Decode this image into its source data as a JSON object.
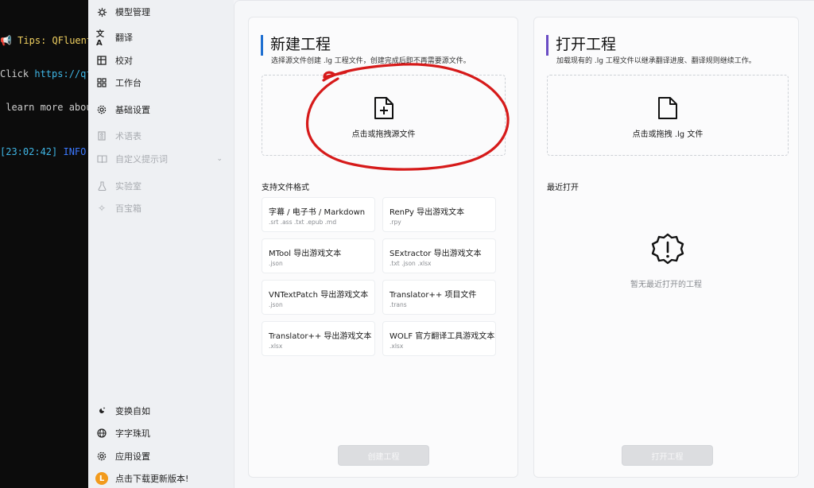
{
  "terminal": {
    "line1_emoji": "📢",
    "line1_text": " Tips: QFluent",
    "line2_prefix": "Click ",
    "line2_link": "https://qf",
    "line3": " learn more abou",
    "line4_time": "[23:02:42]",
    "line4_level": " INFO"
  },
  "sidebar": {
    "items": [
      {
        "label": "模型管理"
      },
      {
        "label": "翻译"
      },
      {
        "label": "校对"
      },
      {
        "label": "工作台"
      },
      {
        "label": "基础设置"
      },
      {
        "label": "术语表"
      },
      {
        "label": "自定义提示词"
      },
      {
        "label": "实验室"
      },
      {
        "label": "百宝箱"
      }
    ],
    "bottom": [
      {
        "label": "变换自如"
      },
      {
        "label": "字字珠玑"
      },
      {
        "label": "应用设置"
      },
      {
        "label": "点击下载更新版本!",
        "badge": "L"
      }
    ]
  },
  "new_project": {
    "title": "新建工程",
    "subtitle": "选择源文件创建 .lg 工程文件，创建完成后即不再需要源文件。",
    "dropzone_label": "点击或拖拽源文件",
    "formats_label": "支持文件格式",
    "formats": [
      {
        "name": "字幕 / 电子书 / Markdown",
        "ext": ".srt .ass .txt .epub .md"
      },
      {
        "name": "RenPy 导出游戏文本",
        "ext": ".rpy"
      },
      {
        "name": "MTool 导出游戏文本",
        "ext": ".json"
      },
      {
        "name": "SExtractor 导出游戏文本",
        "ext": ".txt .json .xlsx"
      },
      {
        "name": "VNTextPatch 导出游戏文本",
        "ext": ".json"
      },
      {
        "name": "Translator++ 项目文件",
        "ext": ".trans"
      },
      {
        "name": "Translator++ 导出游戏文本",
        "ext": ".xlsx"
      },
      {
        "name": "WOLF 官方翻译工具游戏文本",
        "ext": ".xlsx"
      }
    ],
    "button": "创建工程"
  },
  "open_project": {
    "title": "打开工程",
    "subtitle": "加载现有的 .lg 工程文件以继承翻译进度、翻译规则继续工作。",
    "dropzone_label": "点击或拖拽 .lg 文件",
    "recent_label": "最近打开",
    "empty_text": "暂无最近打开的工程",
    "button": "打开工程"
  },
  "colors": {
    "accent_new": "#1f6fd1",
    "accent_open": "#6a4cc4",
    "annotation": "#d61a1a"
  }
}
